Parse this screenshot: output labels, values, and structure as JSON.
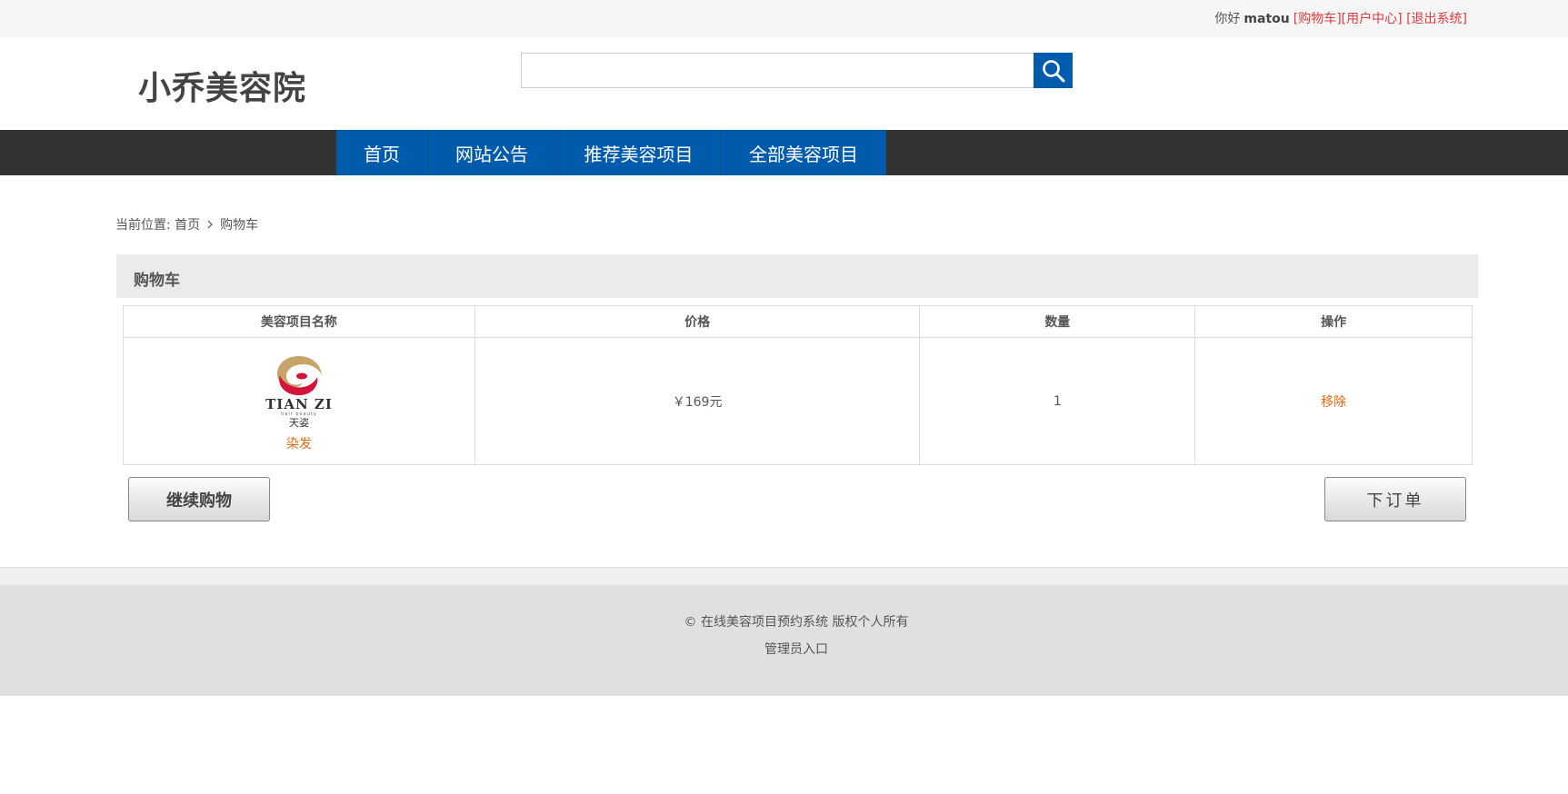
{
  "topbar": {
    "greeting": "你好",
    "username": "matou",
    "links": {
      "cart": "[购物车]",
      "user_center": "[用户中心]",
      "logout": "[退出系统]"
    }
  },
  "header": {
    "logo_text": "小乔美容院",
    "search": {
      "value": "",
      "placeholder": ""
    }
  },
  "nav": {
    "items": [
      {
        "label": "首页"
      },
      {
        "label": "网站公告"
      },
      {
        "label": "推荐美容项目"
      },
      {
        "label": "全部美容项目"
      }
    ]
  },
  "breadcrumb": {
    "prefix": "当前位置:",
    "home": "首页",
    "current": "购物车"
  },
  "cart": {
    "title": "购物车",
    "columns": [
      "美容项目名称",
      "价格",
      "数量",
      "操作"
    ],
    "rows": [
      {
        "logo": {
          "brand": "TIAN ZI",
          "tagline": "hair beauty",
          "cn": "天姿"
        },
        "name": "染发",
        "price": "￥169元",
        "quantity": "1",
        "action": "移除"
      }
    ],
    "continue_label": "继续购物",
    "order_label": "下订单"
  },
  "footer": {
    "copyright": "© 在线美容项目预约系统 版权个人所有",
    "admin_link": "管理员入口"
  },
  "colors": {
    "primary_blue": "#005bac",
    "nav_dark": "#333333",
    "link_red": "#e4393c",
    "accent_orange": "#e76a10"
  }
}
